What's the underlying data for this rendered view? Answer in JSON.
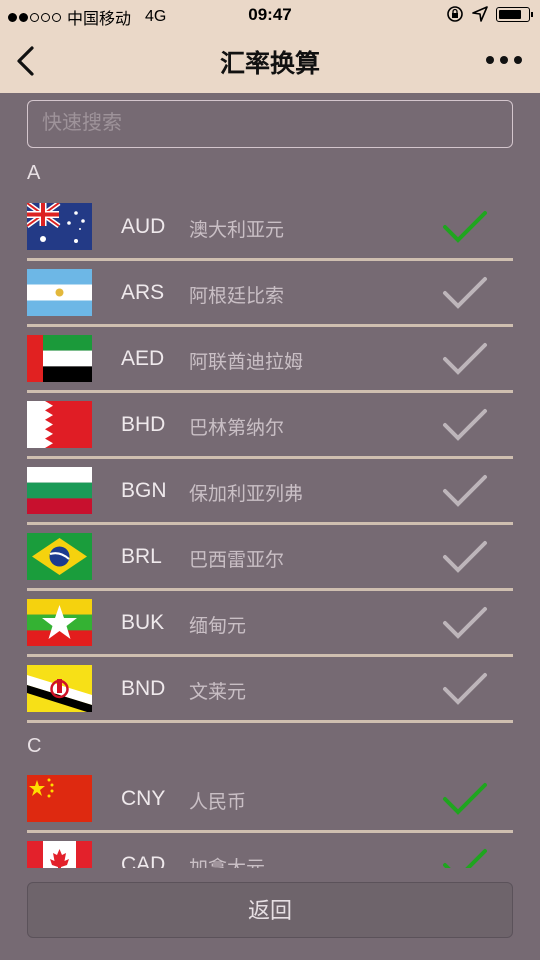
{
  "status": {
    "carrier": "中国移动",
    "network": "4G",
    "time": "09:47"
  },
  "nav": {
    "title": "汇率换算"
  },
  "search": {
    "placeholder": "快速搜索"
  },
  "sections": [
    "A",
    "C"
  ],
  "currencies": [
    {
      "code": "AUD",
      "name": "澳大利亚元",
      "selected": true
    },
    {
      "code": "ARS",
      "name": "阿根廷比索",
      "selected": false
    },
    {
      "code": "AED",
      "name": "阿联酋迪拉姆",
      "selected": false
    },
    {
      "code": "BHD",
      "name": "巴林第纳尔",
      "selected": false
    },
    {
      "code": "BGN",
      "name": "保加利亚列弗",
      "selected": false
    },
    {
      "code": "BRL",
      "name": "巴西雷亚尔",
      "selected": false
    },
    {
      "code": "BUK",
      "name": "缅甸元",
      "selected": false
    },
    {
      "code": "BND",
      "name": "文莱元",
      "selected": false
    },
    {
      "code": "CNY",
      "name": "人民币",
      "selected": true
    },
    {
      "code": "CAD",
      "name": "加拿大元",
      "selected": true
    }
  ],
  "bottom": {
    "button_label": "返回"
  },
  "colors": {
    "selected_check": "#1fa51f",
    "unselected_check": "#bdb5ba",
    "background": "#766a73",
    "topbar": "#ead8c8"
  }
}
